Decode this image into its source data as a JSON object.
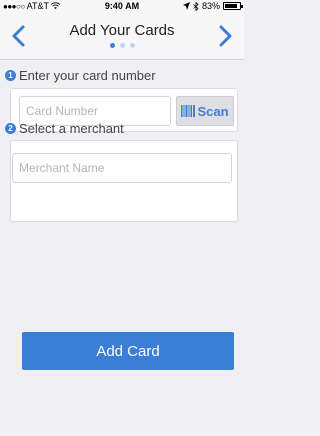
{
  "status_bar": {
    "signal_dots": "●●●○○",
    "carrier": "AT&T",
    "time": "9:40 AM",
    "battery": "83%",
    "battery_level": 0.83
  },
  "nav": {
    "title": "Add Your Cards",
    "back_icon": "chevron-left-icon",
    "forward_icon": "chevron-right-icon",
    "page_count": 3,
    "active_page": 1
  },
  "step1": {
    "number": "1",
    "label": "Enter your card number",
    "card_placeholder": "Card Number",
    "scan_label": "Scan"
  },
  "step2": {
    "number": "2",
    "label": "Select a merchant",
    "merchant_placeholder": "Merchant Name"
  },
  "add_card_label": "Add Card",
  "colors": {
    "accent": "#3a7ed6",
    "background": "#efeff4"
  }
}
